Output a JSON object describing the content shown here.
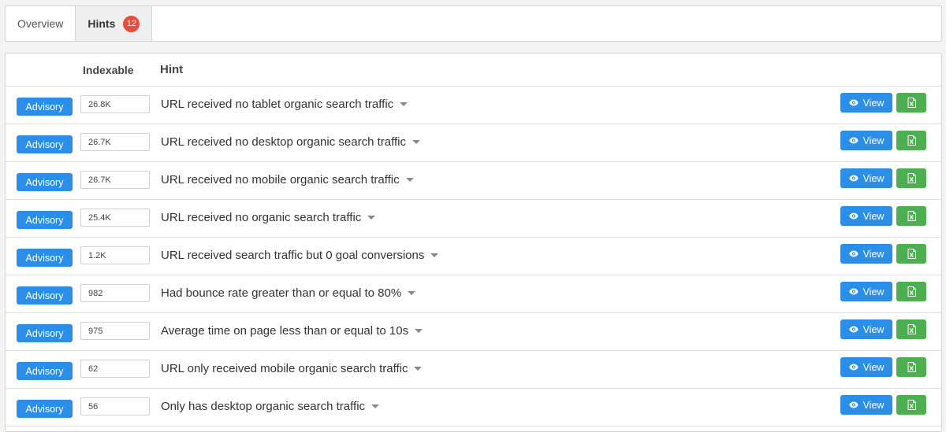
{
  "tabs": {
    "overview_label": "Overview",
    "hints_label": "Hints",
    "hints_count": "12"
  },
  "table": {
    "header_indexable": "Indexable",
    "header_hint": "Hint",
    "view_label": "View",
    "rows": [
      {
        "priority": "Advisory",
        "count": "26.8K",
        "hint": "URL received no tablet organic search traffic"
      },
      {
        "priority": "Advisory",
        "count": "26.7K",
        "hint": "URL received no desktop organic search traffic"
      },
      {
        "priority": "Advisory",
        "count": "26.7K",
        "hint": "URL received no mobile organic search traffic"
      },
      {
        "priority": "Advisory",
        "count": "25.4K",
        "hint": "URL received no organic search traffic"
      },
      {
        "priority": "Advisory",
        "count": "1.2K",
        "hint": "URL received search traffic but 0 goal conversions"
      },
      {
        "priority": "Advisory",
        "count": "982",
        "hint": "Had bounce rate greater than or equal to 80%"
      },
      {
        "priority": "Advisory",
        "count": "975",
        "hint": "Average time on page less than or equal to 10s"
      },
      {
        "priority": "Advisory",
        "count": "62",
        "hint": "URL only received mobile organic search traffic"
      },
      {
        "priority": "Advisory",
        "count": "56",
        "hint": "Only has desktop organic search traffic"
      }
    ]
  },
  "colors": {
    "primary_blue": "#2b8ee8",
    "export_green": "#4caf50",
    "badge_red": "#e74c3c"
  },
  "icons": {
    "view": "eye-icon",
    "export": "excel-file-icon",
    "dropdown": "caret-down-icon"
  }
}
